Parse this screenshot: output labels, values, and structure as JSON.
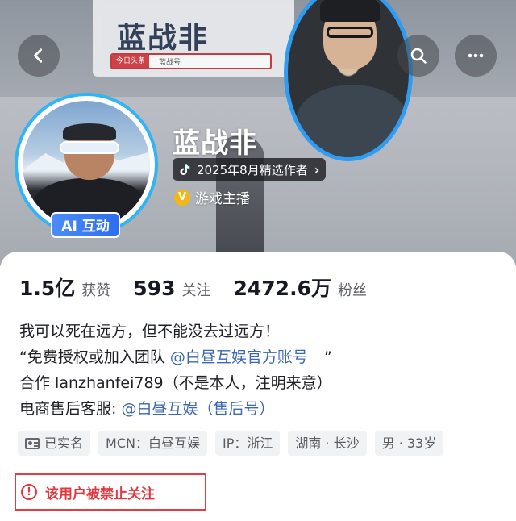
{
  "banner": {
    "background_title": "蓝战非",
    "background_tag": "今日头条",
    "background_search": "蓝战号"
  },
  "header": {
    "back_icon": "chevron-left-icon",
    "search_icon": "search-icon",
    "more_icon": "more-dots-icon"
  },
  "profile": {
    "name": "蓝战非",
    "ai_badge": "AI 互动",
    "creator_badge": "2025年8月精选作者",
    "creator_badge_chevron": "›",
    "verify_icon_letter": "V",
    "verified_title": "游戏主播"
  },
  "stats": [
    {
      "value": "1.5亿",
      "label": "获赞"
    },
    {
      "value": "593",
      "label": "关注"
    },
    {
      "value": "2472.6万",
      "label": "粉丝"
    }
  ],
  "bio": {
    "line1": "我可以死在远方，但不能没去过远方！",
    "line2_prefix": "“免费授权或加入团队",
    "line2_link": "@白昼互娱官方账号",
    "line2_suffix": "”",
    "line3": "合作 lanzhanfei789（不是本人，注明来意）",
    "line4_prefix": "电商售后客服:",
    "line4_link": "@白昼互娱（售后号）"
  },
  "tags": [
    "已实名",
    "MCN：白昼互娱",
    "IP：浙江",
    "湖南 · 长沙",
    "男 · 33岁"
  ],
  "notice": {
    "icon_glyph": "!",
    "text": "该用户被禁止关注"
  },
  "colors": {
    "accent_blue": "#2f9cf2",
    "link_blue": "#3b67b5",
    "warning_red": "#e4363f"
  }
}
